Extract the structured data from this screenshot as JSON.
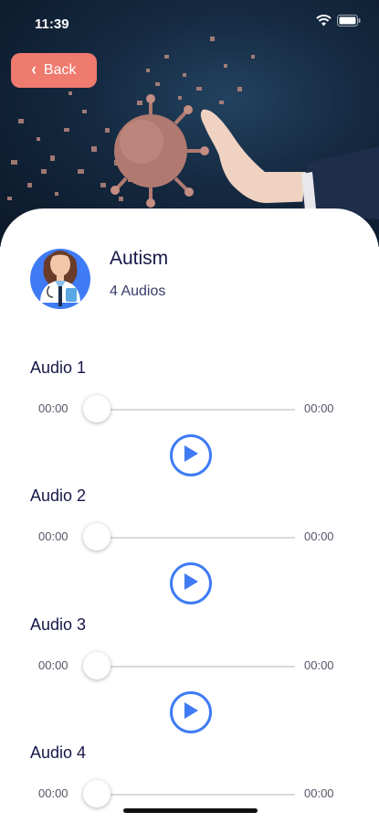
{
  "status_bar": {
    "time": "11:39"
  },
  "back_button": {
    "label": "Back"
  },
  "header": {
    "title": "Autism",
    "subtitle": "4 Audios"
  },
  "audios": [
    {
      "name": "Audio 1",
      "current_time": "00:00",
      "duration": "00:00",
      "progress": 0
    },
    {
      "name": "Audio 2",
      "current_time": "00:00",
      "duration": "00:00",
      "progress": 0
    },
    {
      "name": "Audio 3",
      "current_time": "00:00",
      "duration": "00:00",
      "progress": 0
    },
    {
      "name": "Audio 4",
      "current_time": "00:00",
      "duration": "00:00",
      "progress": 0
    }
  ],
  "colors": {
    "accent": "#3f7bf4",
    "back_button": "#ef7a6e",
    "title_text": "#17174a",
    "hero_background": "#14283f"
  }
}
